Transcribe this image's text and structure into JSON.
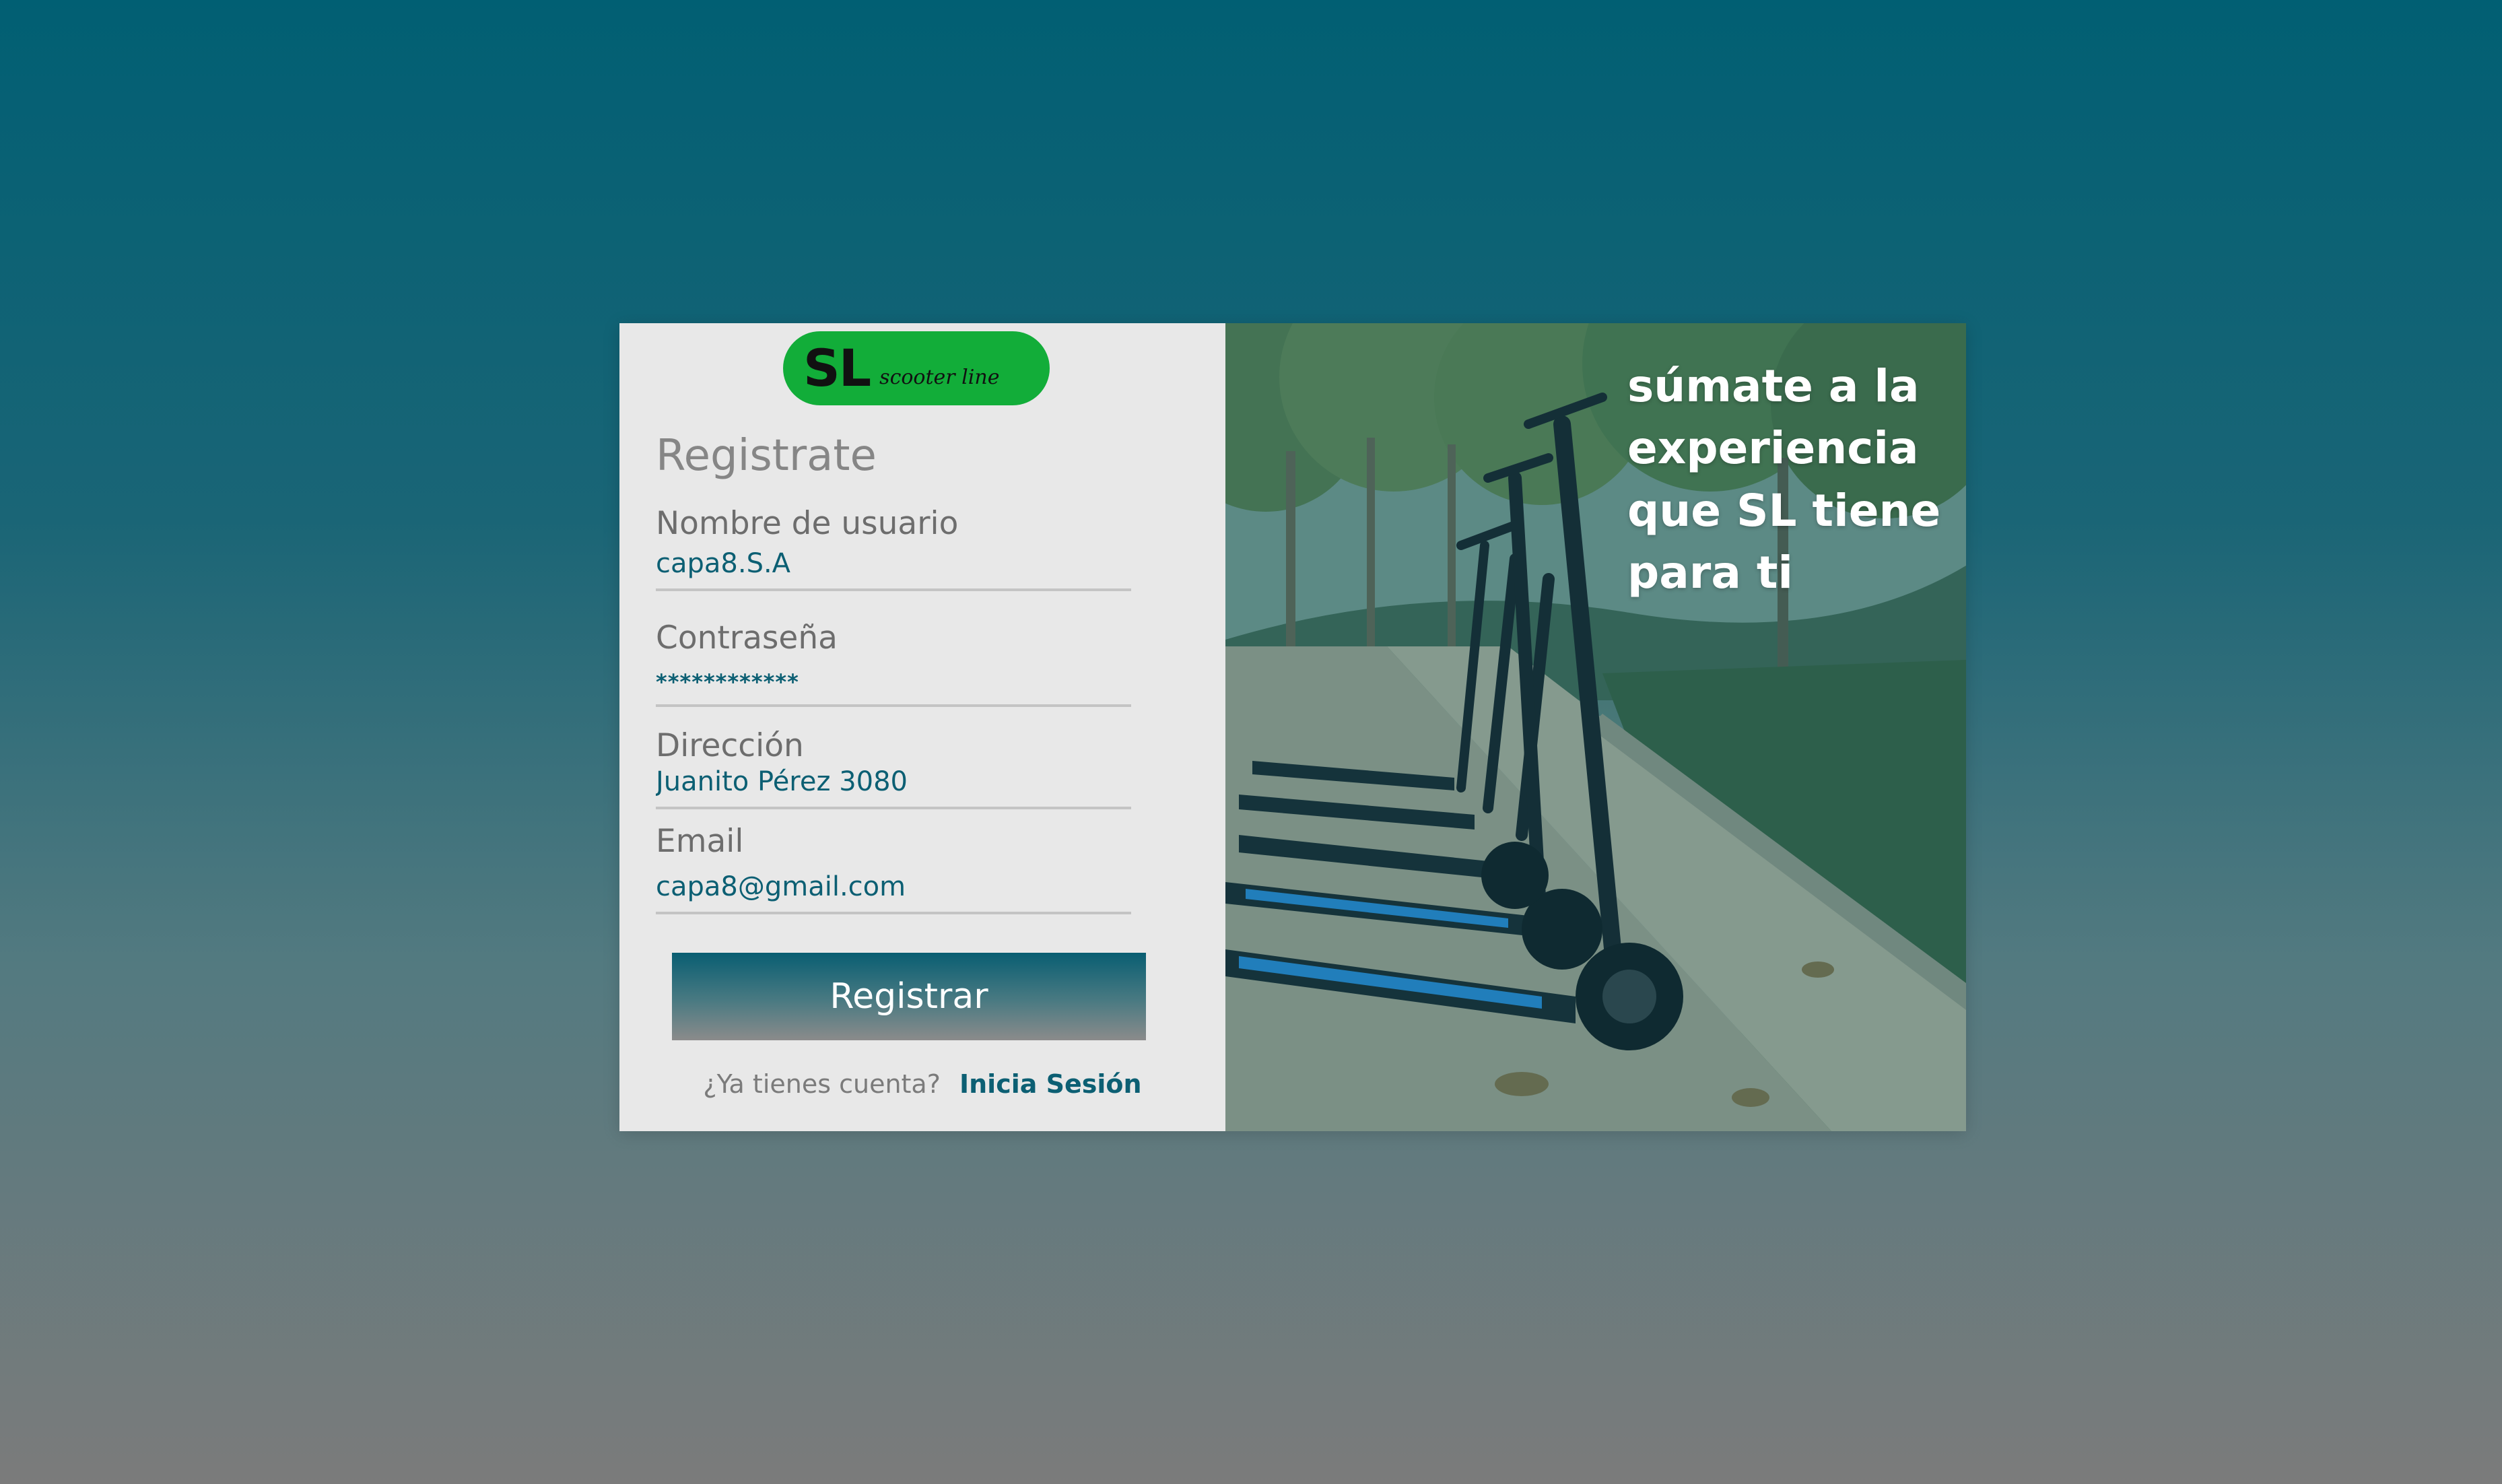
{
  "logo": {
    "brand": "SL",
    "tagline": "scooter line"
  },
  "form": {
    "title": "Registrate",
    "fields": [
      {
        "label": "Nombre de usuario",
        "value": "capa8.S.A"
      },
      {
        "label": "Contraseña",
        "value": "************"
      },
      {
        "label": "Dirección",
        "value": "Juanito Pérez 3080"
      },
      {
        "label": "Email",
        "value": "capa8@gmail.com"
      }
    ],
    "submit_label": "Registrar",
    "login_prompt": "¿Ya tienes cuenta?",
    "login_link": "Inicia Sesión"
  },
  "promo": {
    "text": "súmate a la experiencia que SL tiene para ti"
  },
  "colors": {
    "accent": "#0c5f73",
    "logo_green": "#12ad39",
    "panel_bg": "#e8e8e8"
  },
  "icons": {
    "hero_image": "electric-scooters-photo"
  }
}
